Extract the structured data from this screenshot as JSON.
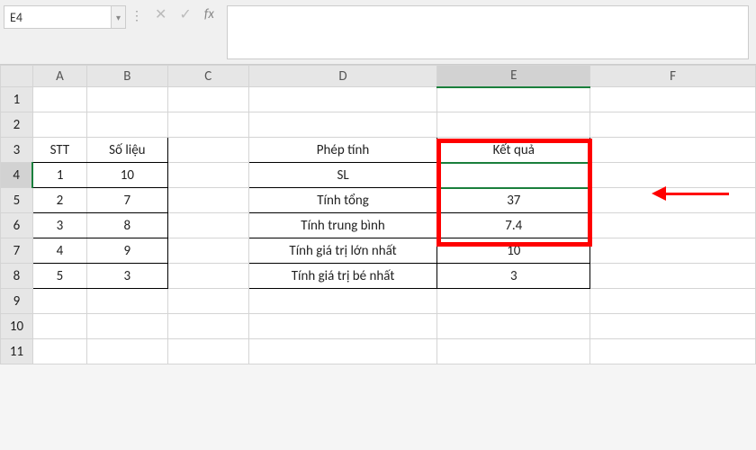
{
  "nameBox": "E4",
  "formulaValue": "",
  "columns": [
    "A",
    "B",
    "C",
    "D",
    "E",
    "F"
  ],
  "rows": [
    "1",
    "2",
    "3",
    "4",
    "5",
    "6",
    "7",
    "8",
    "9",
    "10",
    "11"
  ],
  "cells": {
    "A3": "STT",
    "B3": "Số liệu",
    "D3": "Phép tính",
    "E3": "Kết quả",
    "A4": "1",
    "B4": "10",
    "D4": "SL",
    "E4": "",
    "A5": "2",
    "B5": "7",
    "D5": "Tính tổng",
    "E5": "37",
    "A6": "3",
    "B6": "8",
    "D6": "Tính trung bình",
    "E6": "7.4",
    "A7": "4",
    "B7": "9",
    "D7": "Tính giá trị lớn nhất",
    "E7": "10",
    "A8": "5",
    "B8": "3",
    "D8": "Tính giá trị bé nhất",
    "E8": "3"
  },
  "chart_data": {
    "type": "table",
    "tables": [
      {
        "title": "Số liệu",
        "columns": [
          "STT",
          "Số liệu"
        ],
        "rows": [
          [
            1,
            10
          ],
          [
            2,
            7
          ],
          [
            3,
            8
          ],
          [
            4,
            9
          ],
          [
            5,
            3
          ]
        ]
      },
      {
        "title": "Phép tính / Kết quả",
        "columns": [
          "Phép tính",
          "Kết quả"
        ],
        "rows": [
          [
            "SL",
            null
          ],
          [
            "Tính tổng",
            37
          ],
          [
            "Tính trung bình",
            7.4
          ],
          [
            "Tính giá trị lớn nhất",
            10
          ],
          [
            "Tính giá trị bé nhất",
            3
          ]
        ]
      }
    ]
  }
}
